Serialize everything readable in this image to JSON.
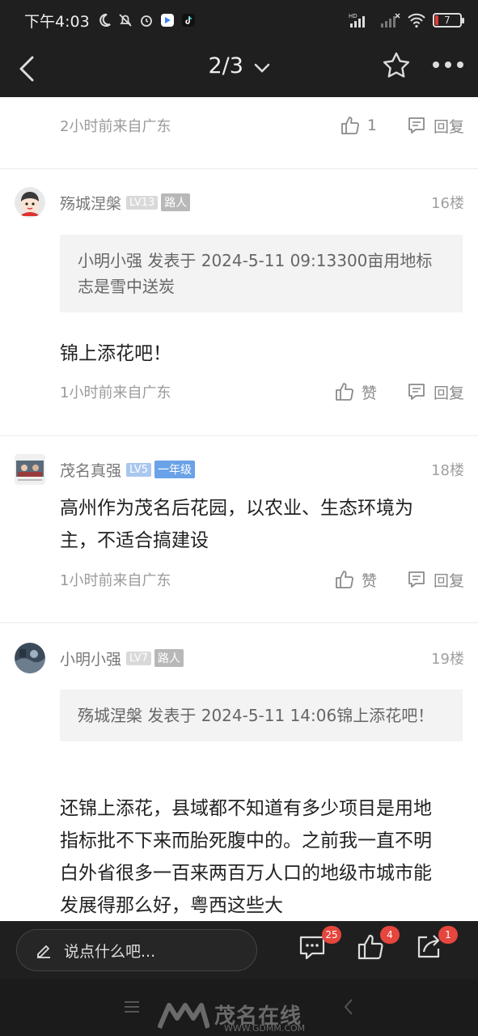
{
  "status": {
    "time": "下午4:03",
    "battery": "7",
    "network_label": "HD"
  },
  "nav": {
    "page_indicator": "2/3"
  },
  "comments": [
    {
      "time": "2小时前来自广东",
      "like_label": "1",
      "reply_label": "回复"
    },
    {
      "user": "殇城涅槃",
      "level": "LV13",
      "role": "路人",
      "floor": "16楼",
      "quote": "小明小强 发表于 2024-5-11 09:13300亩用地标志是雪中送炭",
      "text": "锦上添花吧！",
      "time": "1小时前来自广东",
      "like_label": "赞",
      "reply_label": "回复"
    },
    {
      "user": "茂名真强",
      "level": "LV5",
      "role": "一年级",
      "floor": "18楼",
      "text": "高州作为茂名后花园，以农业、生态环境为主，不适合搞建设",
      "time": "1小时前来自广东",
      "like_label": "赞",
      "reply_label": "回复"
    },
    {
      "user": "小明小强",
      "level": "LV7",
      "role": "路人",
      "floor": "19楼",
      "quote": "殇城涅槃 发表于 2024-5-11 14:06锦上添花吧！",
      "text": "还锦上添花，县域都不知道有多少项目是用地指标批不下来而胎死腹中的。之前我一直不明白外省很多一百来两百万人口的地级市城市能发展得那么好，粤西这些大"
    }
  ],
  "bottom": {
    "input_placeholder": "说点什么吧...",
    "comments_badge": "25",
    "likes_badge": "4",
    "share_badge": "1"
  },
  "watermark": {
    "text": "茂名在线",
    "url": "WWW.GDMM.COM"
  },
  "colors": {
    "accent_badge": "#e5463d",
    "level_blue": "#a9c7ef",
    "role_blue": "#6aa2e8"
  }
}
